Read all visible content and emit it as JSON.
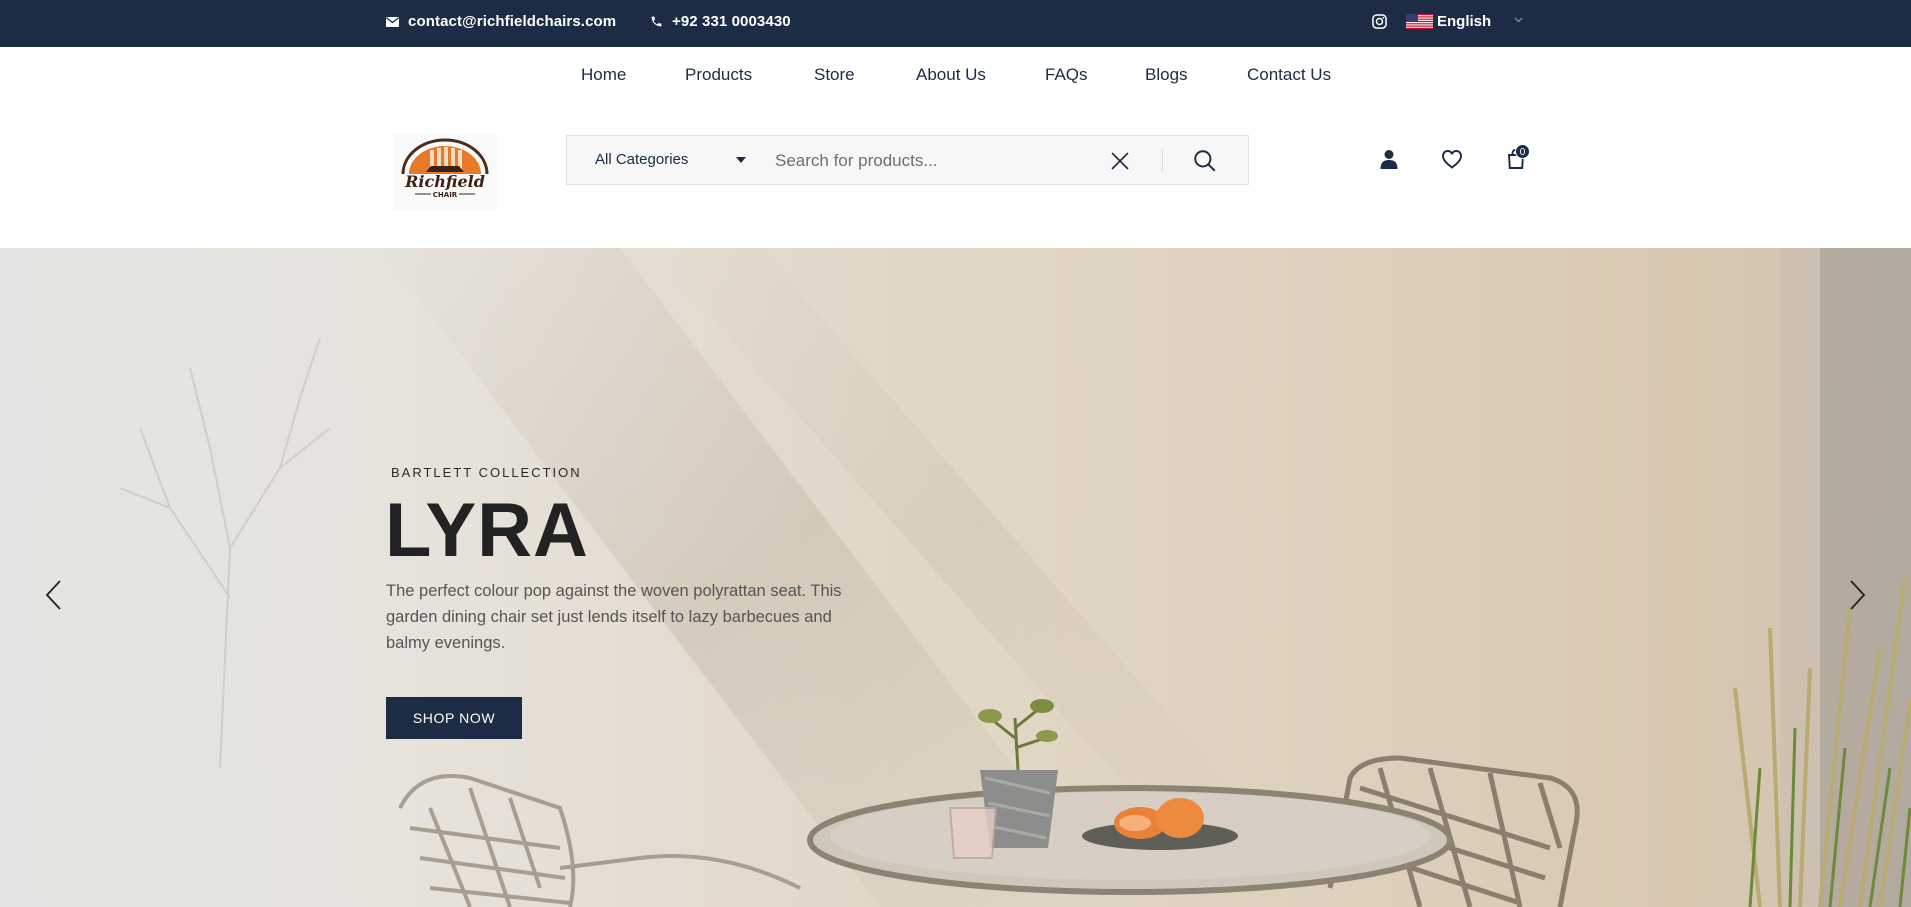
{
  "topbar": {
    "email": "contact@richfieldchairs.com",
    "phone": "+92 331 0003430",
    "language": "English"
  },
  "nav": {
    "items": [
      "Home",
      "Products",
      "Store",
      "About Us",
      "FAQs",
      "Blogs",
      "Contact Us"
    ]
  },
  "logo": {
    "text": "Richfield",
    "subtext": "CHAIR"
  },
  "search": {
    "category": "All Categories",
    "placeholder": "Search for products..."
  },
  "cart": {
    "count": "0"
  },
  "hero": {
    "subtitle": "BARTLETT COLLECTION",
    "title": "LYRA",
    "description": "The perfect colour pop against the woven polyrattan seat. This garden dining chair set just lends itself to lazy barbecues and balmy evenings.",
    "button": "SHOP NOW"
  },
  "colors": {
    "primary": "#1b2c44",
    "accent": "#e8792a"
  },
  "icons": [
    "envelope-icon",
    "phone-icon",
    "instagram-icon",
    "us-flag-icon",
    "chevron-down-icon",
    "close-icon",
    "search-icon",
    "user-icon",
    "heart-icon",
    "cart-icon",
    "arrow-left-icon",
    "arrow-right-icon"
  ]
}
